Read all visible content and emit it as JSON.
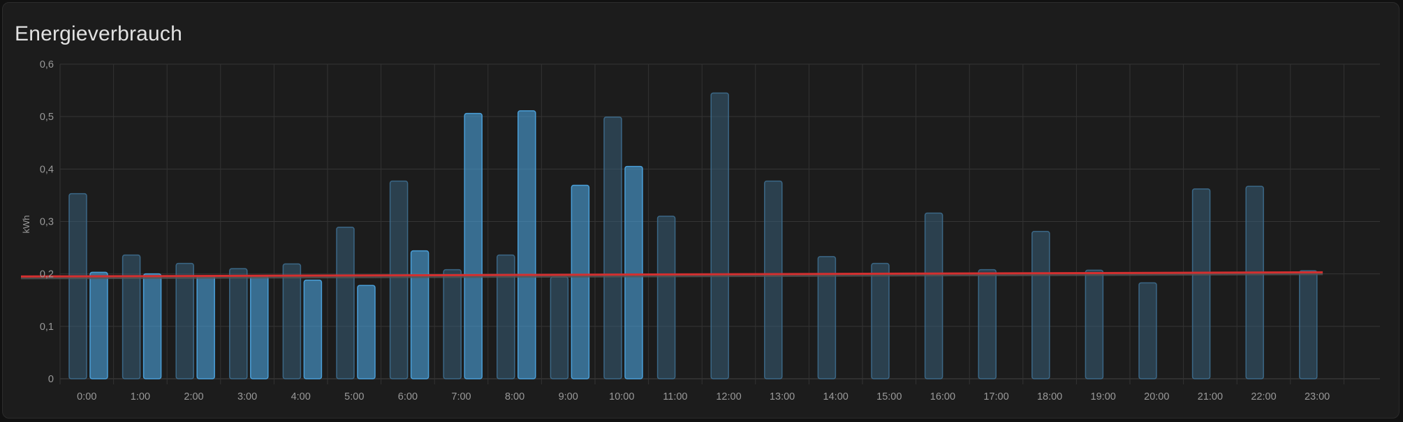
{
  "card": {
    "title": "Energieverbrauch"
  },
  "chart_data": {
    "type": "bar",
    "title": "Energieverbrauch",
    "ylabel": "kWh",
    "xlabel": "",
    "ylim": [
      0,
      0.6
    ],
    "yticks": [
      "0",
      "0,1",
      "0,2",
      "0,3",
      "0,4",
      "0,5",
      "0,6"
    ],
    "grid": true,
    "categories": [
      "0:00",
      "1:00",
      "2:00",
      "3:00",
      "4:00",
      "5:00",
      "6:00",
      "7:00",
      "8:00",
      "9:00",
      "10:00",
      "11:00",
      "12:00",
      "13:00",
      "14:00",
      "15:00",
      "16:00",
      "17:00",
      "18:00",
      "19:00",
      "20:00",
      "21:00",
      "22:00",
      "23:00"
    ],
    "series": [
      {
        "color": "#3e6e8f",
        "style": "faded",
        "values": [
          0.353,
          0.236,
          0.22,
          0.21,
          0.219,
          0.289,
          0.377,
          0.208,
          0.236,
          0.194,
          0.499,
          0.31,
          0.545,
          0.377,
          0.233,
          0.22,
          0.316,
          0.208,
          0.281,
          0.207,
          0.183,
          0.362,
          0.367,
          0.206
        ]
      },
      {
        "color": "#4a9fd8",
        "style": "solid",
        "values": [
          0.203,
          0.2,
          0.196,
          0.196,
          0.188,
          0.178,
          0.244,
          0.506,
          0.511,
          0.369,
          0.405
        ]
      },
      {
        "type": "line",
        "color": "#d32f2f",
        "values_start_end": [
          0.195,
          0.203
        ]
      }
    ]
  }
}
